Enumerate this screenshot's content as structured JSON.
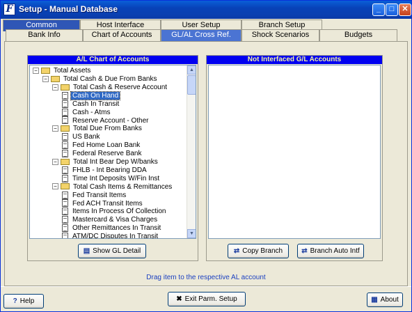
{
  "window": {
    "title": "Setup - Manual Database",
    "app_icon": "F",
    "controls": [
      "minimize",
      "maximize",
      "close"
    ]
  },
  "tabs_top": [
    {
      "label": "Common",
      "selected": true
    },
    {
      "label": "Host Interface"
    },
    {
      "label": "User Setup"
    },
    {
      "label": "Branch Setup"
    }
  ],
  "tabs_sub": [
    {
      "label": "Bank Info"
    },
    {
      "label": "Chart of Accounts"
    },
    {
      "label": "GL/AL Cross Ref.",
      "selected": true
    },
    {
      "label": "Shock Scenarios"
    },
    {
      "label": "Budgets"
    }
  ],
  "al_panel": {
    "title": "A/L Chart of Accounts",
    "tree": [
      {
        "level": 0,
        "type": "folder",
        "label": "Total Assets"
      },
      {
        "level": 1,
        "type": "folder",
        "label": "Total Cash & Due From Banks"
      },
      {
        "level": 2,
        "type": "folder",
        "label": "Total Cash & Reserve Account"
      },
      {
        "level": 3,
        "type": "doc",
        "label": "Cash On Hand",
        "selected": true
      },
      {
        "level": 3,
        "type": "doc",
        "label": "Cash In Transit"
      },
      {
        "level": 3,
        "type": "doc",
        "label": "Cash - Atms"
      },
      {
        "level": 3,
        "type": "doc",
        "label": "Reserve Account - Other"
      },
      {
        "level": 2,
        "type": "folder",
        "label": "Total Due From Banks"
      },
      {
        "level": 3,
        "type": "doc",
        "label": "US Bank"
      },
      {
        "level": 3,
        "type": "doc",
        "label": "Fed Home Loan Bank"
      },
      {
        "level": 3,
        "type": "doc",
        "label": "Federal Reserve Bank"
      },
      {
        "level": 2,
        "type": "folder",
        "label": "Total Int Bear Dep W/banks"
      },
      {
        "level": 3,
        "type": "doc",
        "label": "FHLB - Int Bearing DDA"
      },
      {
        "level": 3,
        "type": "doc",
        "label": "Time Int Deposits W/Fin Inst"
      },
      {
        "level": 2,
        "type": "folder",
        "label": "Total Cash Items & Remittances"
      },
      {
        "level": 3,
        "type": "doc",
        "label": "Fed Transit Items"
      },
      {
        "level": 3,
        "type": "doc",
        "label": "Fed ACH Transit Items"
      },
      {
        "level": 3,
        "type": "doc",
        "label": "Items In Process Of Collection"
      },
      {
        "level": 3,
        "type": "doc",
        "label": "Mastercard & Visa Charges"
      },
      {
        "level": 3,
        "type": "doc",
        "label": "Other Remittances In Transit"
      },
      {
        "level": 3,
        "type": "doc",
        "label": "ATM/DC Disputes In Transit"
      }
    ],
    "show_gl_button": "Show GL Detail"
  },
  "gl_panel": {
    "title": "Not Interfaced G/L Accounts",
    "items": [],
    "copy_branch_button": "Copy Branch",
    "branch_auto_button": "Branch Auto Intf"
  },
  "hint_text": "Drag item to the respective AL account",
  "footer": {
    "help_button": "Help",
    "exit_button": "Exit Parm. Setup",
    "about_button": "About"
  }
}
